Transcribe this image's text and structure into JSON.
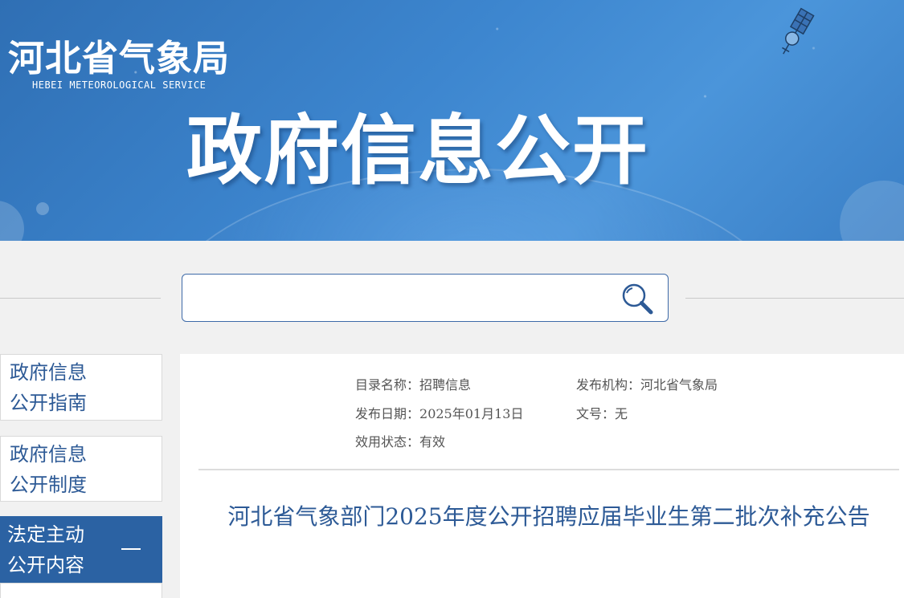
{
  "banner": {
    "logo_cn": "河北省气象局",
    "logo_en": "HEBEI METEOROLOGICAL SERVICE",
    "title": "政府信息公开",
    "colors": {
      "primary": "#3d86cf",
      "dark": "#2f6fb4"
    },
    "icons": [
      "satellite-icon"
    ]
  },
  "search": {
    "placeholder": "",
    "value": "",
    "icon": "search-icon"
  },
  "sidebar": {
    "items": [
      {
        "label_line1": "政府信息",
        "label_line2": "公开指南"
      },
      {
        "label_line1": "政府信息",
        "label_line2": "公开制度"
      },
      {
        "label_line1": "法定主动",
        "label_line2": "公开内容",
        "active": true,
        "toggle_icon": "collapse-icon"
      }
    ],
    "active_color": "#2b62a3"
  },
  "document": {
    "catalog_label": "目录名称：",
    "catalog_value": "招聘信息",
    "publisher_label": "发布机构：",
    "publisher_value": "河北省气象局",
    "date_label": "发布日期：",
    "date_value": "2025年01月13日",
    "doc_no_label": "文号：",
    "doc_no_value": "无",
    "status_label": "效用状态：",
    "status_value": "有效",
    "title": "河北省气象部门2025年度公开招聘应届毕业生第二批次补充公告"
  }
}
